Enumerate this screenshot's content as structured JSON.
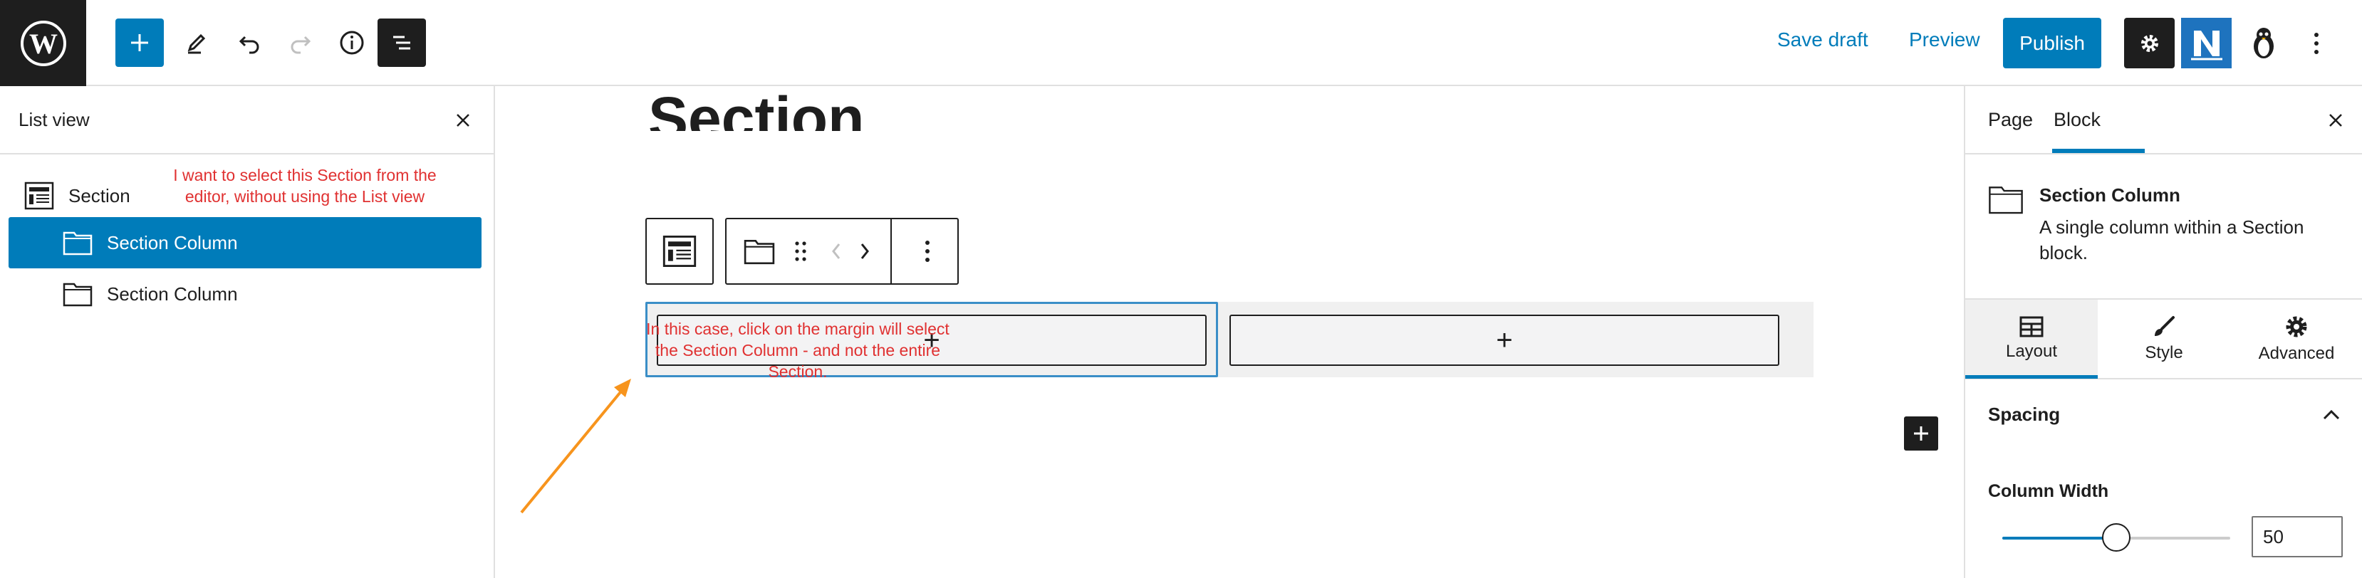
{
  "header": {
    "save_draft_label": "Save draft",
    "preview_label": "Preview",
    "publish_label": "Publish",
    "icons": [
      "wordpress-logo",
      "plus-icon",
      "pencil-icon",
      "undo-icon",
      "redo-icon",
      "info-icon",
      "list-view-icon",
      "gear-icon",
      "n-plugin-icon",
      "penguin-icon",
      "more-vertical-icon"
    ],
    "colors": {
      "accent": "#007cba",
      "dark": "#1e1e1e"
    }
  },
  "listview": {
    "title": "List view",
    "items": [
      {
        "label": "Section",
        "selected": false
      },
      {
        "label": "Section Column",
        "selected": true
      },
      {
        "label": "Section Column",
        "selected": false
      }
    ]
  },
  "annotations": {
    "note1": "I want to select this Section from the editor, without using the List view",
    "note2": "In this case, click on the margin will select the Section Column - and not the entire Section.",
    "color": "#e03131",
    "arrow_color": "#f7941d"
  },
  "canvas": {
    "section_title": "Section",
    "add_block_symbol": "+"
  },
  "sidebar": {
    "tab_page": "Page",
    "tab_block": "Block",
    "block_name": "Section Column",
    "block_desc": "A single column within a Section block.",
    "subtabs": [
      "Layout",
      "Style",
      "Advanced"
    ],
    "spacing_title": "Spacing",
    "column_width_label": "Column Width",
    "column_width_value": "50",
    "column_width_min": 0,
    "column_width_max": 100
  }
}
